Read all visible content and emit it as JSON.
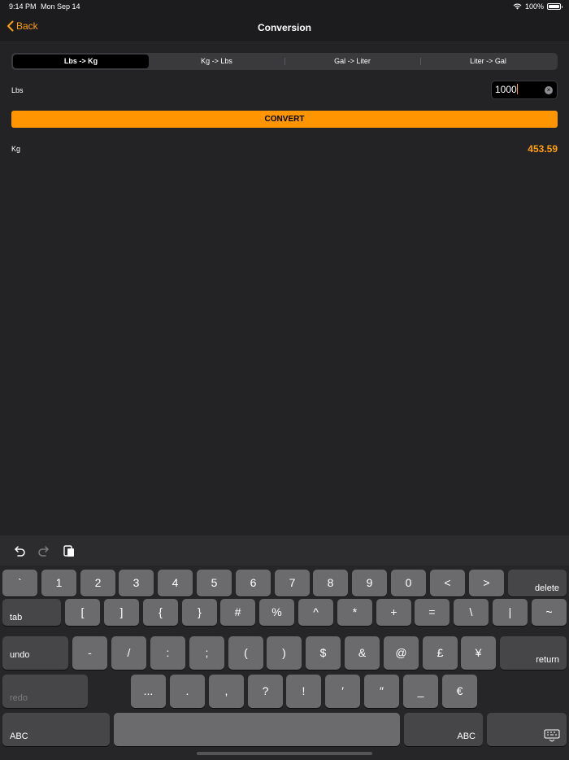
{
  "status": {
    "time": "9:14 PM",
    "date": "Mon Sep 14",
    "battery": "100%"
  },
  "nav": {
    "back_label": "Back",
    "title": "Conversion"
  },
  "segments": [
    "Lbs -> Kg",
    "Kg -> Lbs",
    "Gal -> Liter",
    "Liter -> Gal"
  ],
  "selected_segment": "Lbs -> Kg",
  "input": {
    "label": "Lbs",
    "value": "1000"
  },
  "convert_label": "CONVERT",
  "result": {
    "label": "Kg",
    "value": "453.59"
  },
  "keyboard": {
    "row1": [
      "`",
      "1",
      "2",
      "3",
      "4",
      "5",
      "6",
      "7",
      "8",
      "9",
      "0",
      "<",
      ">"
    ],
    "delete": "delete",
    "tab": "tab",
    "row2": [
      "[",
      "]",
      "{",
      "}",
      "#",
      "%",
      "^",
      "*",
      "+",
      "=",
      "\\",
      "|",
      "~"
    ],
    "undo": "undo",
    "row3": [
      "-",
      "/",
      ":",
      ";",
      "(",
      ")",
      "$",
      "&",
      "@",
      "£",
      "¥"
    ],
    "return": "return",
    "redo": "redo",
    "row4": [
      "...",
      ".",
      ",",
      "?",
      "!",
      "′",
      "″",
      "_",
      "€"
    ],
    "abc_left": "ABC",
    "abc_right": "ABC"
  },
  "colors": {
    "accent": "#ff9f0a",
    "convert_button": "#ff9500",
    "background": "#1c1c1e"
  }
}
